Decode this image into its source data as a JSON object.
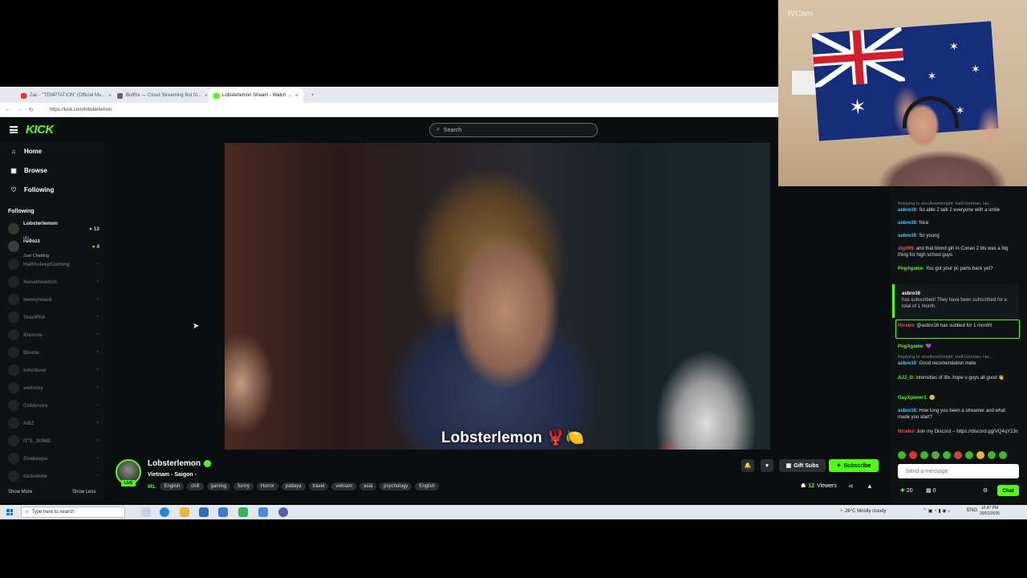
{
  "browser": {
    "tabs": [
      {
        "title": "Zac - \"TEMPTATION\" (Official Mu...",
        "color": "#e33",
        "active": false
      },
      {
        "title": "BotRix — Cloud Streaming Bot fo...",
        "color": "#666",
        "active": false
      },
      {
        "title": "Lobsterlemon Stream - Watch ...",
        "color": "#53fc18",
        "active": true
      }
    ],
    "url": "https://kick.com/lobsterlemon"
  },
  "kick": {
    "logo": "KICK",
    "search_placeholder": "Search",
    "nav": [
      {
        "icon": "home-icon",
        "label": "Home"
      },
      {
        "icon": "compass-icon",
        "label": "Browse"
      },
      {
        "icon": "heart-icon",
        "label": "Following"
      }
    ],
    "following_header": "Following",
    "following": [
      {
        "name": "Lobsterlemon",
        "sub": "IRL",
        "count": "12",
        "live": true
      },
      {
        "name": "rudozz",
        "sub": "Just Chatting",
        "count": "4",
        "live": true
      },
      {
        "name": "HalfAsleepGaming",
        "sub": "",
        "count": "",
        "live": false
      },
      {
        "name": "Xenathewitch",
        "sub": "",
        "count": "",
        "live": false
      },
      {
        "name": "bennymack",
        "sub": "",
        "count": "",
        "live": false
      },
      {
        "name": "TeariPhil",
        "sub": "",
        "count": "",
        "live": false
      },
      {
        "name": "iDuncle",
        "sub": "",
        "count": "",
        "live": false
      },
      {
        "name": "Blonie",
        "sub": "",
        "count": "",
        "live": false
      },
      {
        "name": "mhotkow",
        "sub": "",
        "count": "",
        "live": false
      },
      {
        "name": "vmhony",
        "sub": "",
        "count": "",
        "live": false
      },
      {
        "name": "Cobbruvs",
        "sub": "",
        "count": "",
        "live": false
      },
      {
        "name": "ABZ",
        "sub": "",
        "count": "",
        "live": false
      },
      {
        "name": "IT'S_JUNIE",
        "sub": "",
        "count": "",
        "live": false
      },
      {
        "name": "Zookeepa",
        "sub": "",
        "count": "",
        "live": false
      },
      {
        "name": "nickwhite",
        "sub": "",
        "count": "",
        "live": false
      }
    ],
    "show_more": "Show More",
    "show_less": "Show Less"
  },
  "video": {
    "caption": "Lobsterlemon 🦞🍋"
  },
  "stream": {
    "channel": "Lobsterlemon",
    "live_badge": "LIVE",
    "title": "Vietnam - Saigon -",
    "category": "IRL",
    "tags": [
      "English",
      "chill",
      "gaming",
      "funny",
      "Horror",
      "pattaya",
      "travel",
      "vietnam",
      "asia",
      "psychology",
      "English"
    ],
    "gift_label": "Gift Subs",
    "subscribe_label": "Subscribe",
    "viewers_count": "12",
    "viewers_label": "Viewers"
  },
  "chat": {
    "messages": [
      {
        "reply": "Replying to stoutbeertonight: Half-German, Ha...",
        "user": "asbro16",
        "color": "#4fc3f7",
        "text": "So able 2 talk 2 everyone with a smile"
      },
      {
        "reply": "",
        "user": "asbro16",
        "color": "#4fc3f7",
        "text": "Nice"
      },
      {
        "reply": "",
        "user": "asbro16",
        "color": "#4fc3f7",
        "text": "So young"
      },
      {
        "reply": "",
        "user": "digit99",
        "color": "#e05555",
        "text": "and that blond girl in Conan 2 tits was a big thing for high school guys"
      },
      {
        "reply": "",
        "user": "PogAgame",
        "color": "#53fc18",
        "text": "You got your pc parts back yet?"
      }
    ],
    "sub_notice": {
      "user": "asbro16",
      "text": "has subscribed! They have been subscribed for a total of 1 month."
    },
    "highlight": {
      "user": "Nicebo",
      "text": "@asbro16 has subbed for 1 month!"
    },
    "messages2": [
      {
        "reply": "",
        "user": "PogAgame",
        "color": "#53fc18",
        "text": "💜"
      },
      {
        "reply": "Replying to stoutbeertonight: Half-German, Ha...",
        "user": "asbro16",
        "color": "#4fc3f7",
        "text": "Good recomendation mate"
      },
      {
        "reply": "",
        "user": "AJJ_G",
        "color": "#53fc18",
        "text": "intensities of life..hope u guys all good 👋"
      },
      {
        "reply": "",
        "user": "GayXplorer1",
        "color": "#53fc18",
        "text": "🙂"
      },
      {
        "reply": "",
        "user": "asbro16",
        "color": "#4fc3f7",
        "text": "How long you been a streamer and what made you start?"
      },
      {
        "reply": "",
        "user": "Nicebo",
        "color": "#e05555",
        "text": "Join my Discord -- https://discord.gg/VQ4qY2Jn"
      }
    ],
    "input_placeholder": "Send a message",
    "points": "20",
    "gifts": "0",
    "send_label": "Chat"
  },
  "webcam": {
    "label": "IVCam"
  },
  "taskbar": {
    "search_placeholder": "Type here to search",
    "weather": "26°C  Mostly cloudy",
    "lang": "ENG",
    "time": "10:47 PM",
    "date": "29/01/2026"
  }
}
